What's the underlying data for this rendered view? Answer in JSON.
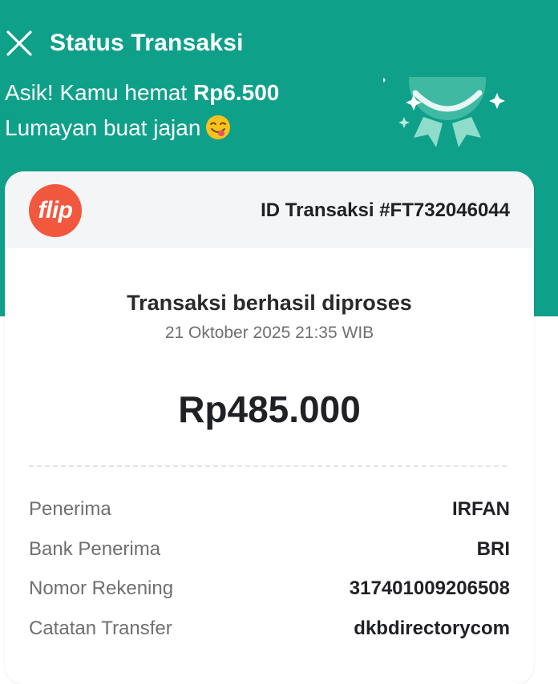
{
  "header": {
    "title": "Status Transaksi",
    "close_icon": "close-icon"
  },
  "promo": {
    "line1_prefix": "Asik! Kamu hemat ",
    "saving_amount": "Rp6.500",
    "line2": "Lumayan buat jajan",
    "emoji": "yum-emoji-icon",
    "decoration_icon": "savings-badge-icon"
  },
  "card": {
    "logo_text": "flip",
    "transaction_id": "ID Transaksi #FT732046044",
    "status_title": "Transaksi berhasil diproses",
    "date": "21 Oktober 2025 21:35 WIB",
    "amount": "Rp485.000",
    "details": [
      {
        "label": "Penerima",
        "value": "IRFAN"
      },
      {
        "label": "Bank Penerima",
        "value": "BRI"
      },
      {
        "label": "Nomor Rekening",
        "value": "317401009206508"
      },
      {
        "label": "Catatan Transfer",
        "value": "dkbdirectorycom"
      }
    ]
  },
  "colors": {
    "brand_green": "#0fa08a",
    "flip_orange": "#f2583e",
    "card_header_gray": "#f4f5f7"
  }
}
